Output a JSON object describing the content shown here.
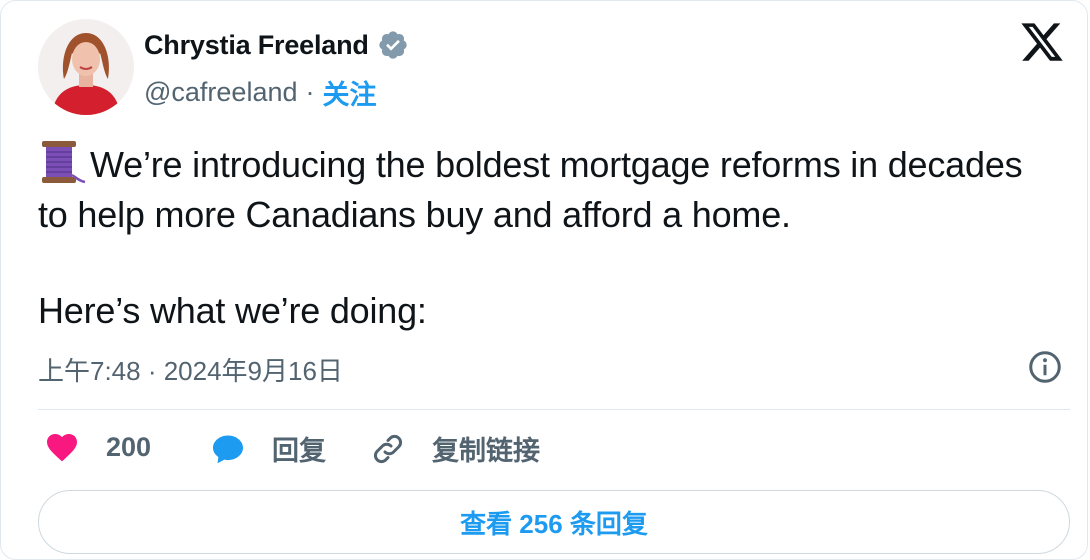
{
  "author": {
    "name": "Chrystia Freeland",
    "handle": "@cafreeland",
    "separator": "·",
    "follow_label": "关注"
  },
  "tweet": {
    "line1": "We’re introducing the boldest mortgage reforms in decades to help more Canadians buy and afford a home.",
    "line2": "Here’s what we’re doing:"
  },
  "timestamp": "上午7:48 · 2024年9月16日",
  "actions": {
    "like_count": "200",
    "reply_label": "回复",
    "copy_link_label": "复制链接"
  },
  "view_replies_label": "查看 256 条回复",
  "icons": {
    "brand": "x-logo-icon",
    "verified": "verified-badge-icon",
    "emoji": "thread-spool-emoji",
    "info": "info-icon",
    "like": "heart-icon",
    "reply": "speech-bubble-icon",
    "link": "link-icon"
  },
  "colors": {
    "accent": "#1d9bf0",
    "like": "#f91880",
    "muted": "#536471",
    "verified_badge": "#829aab"
  }
}
